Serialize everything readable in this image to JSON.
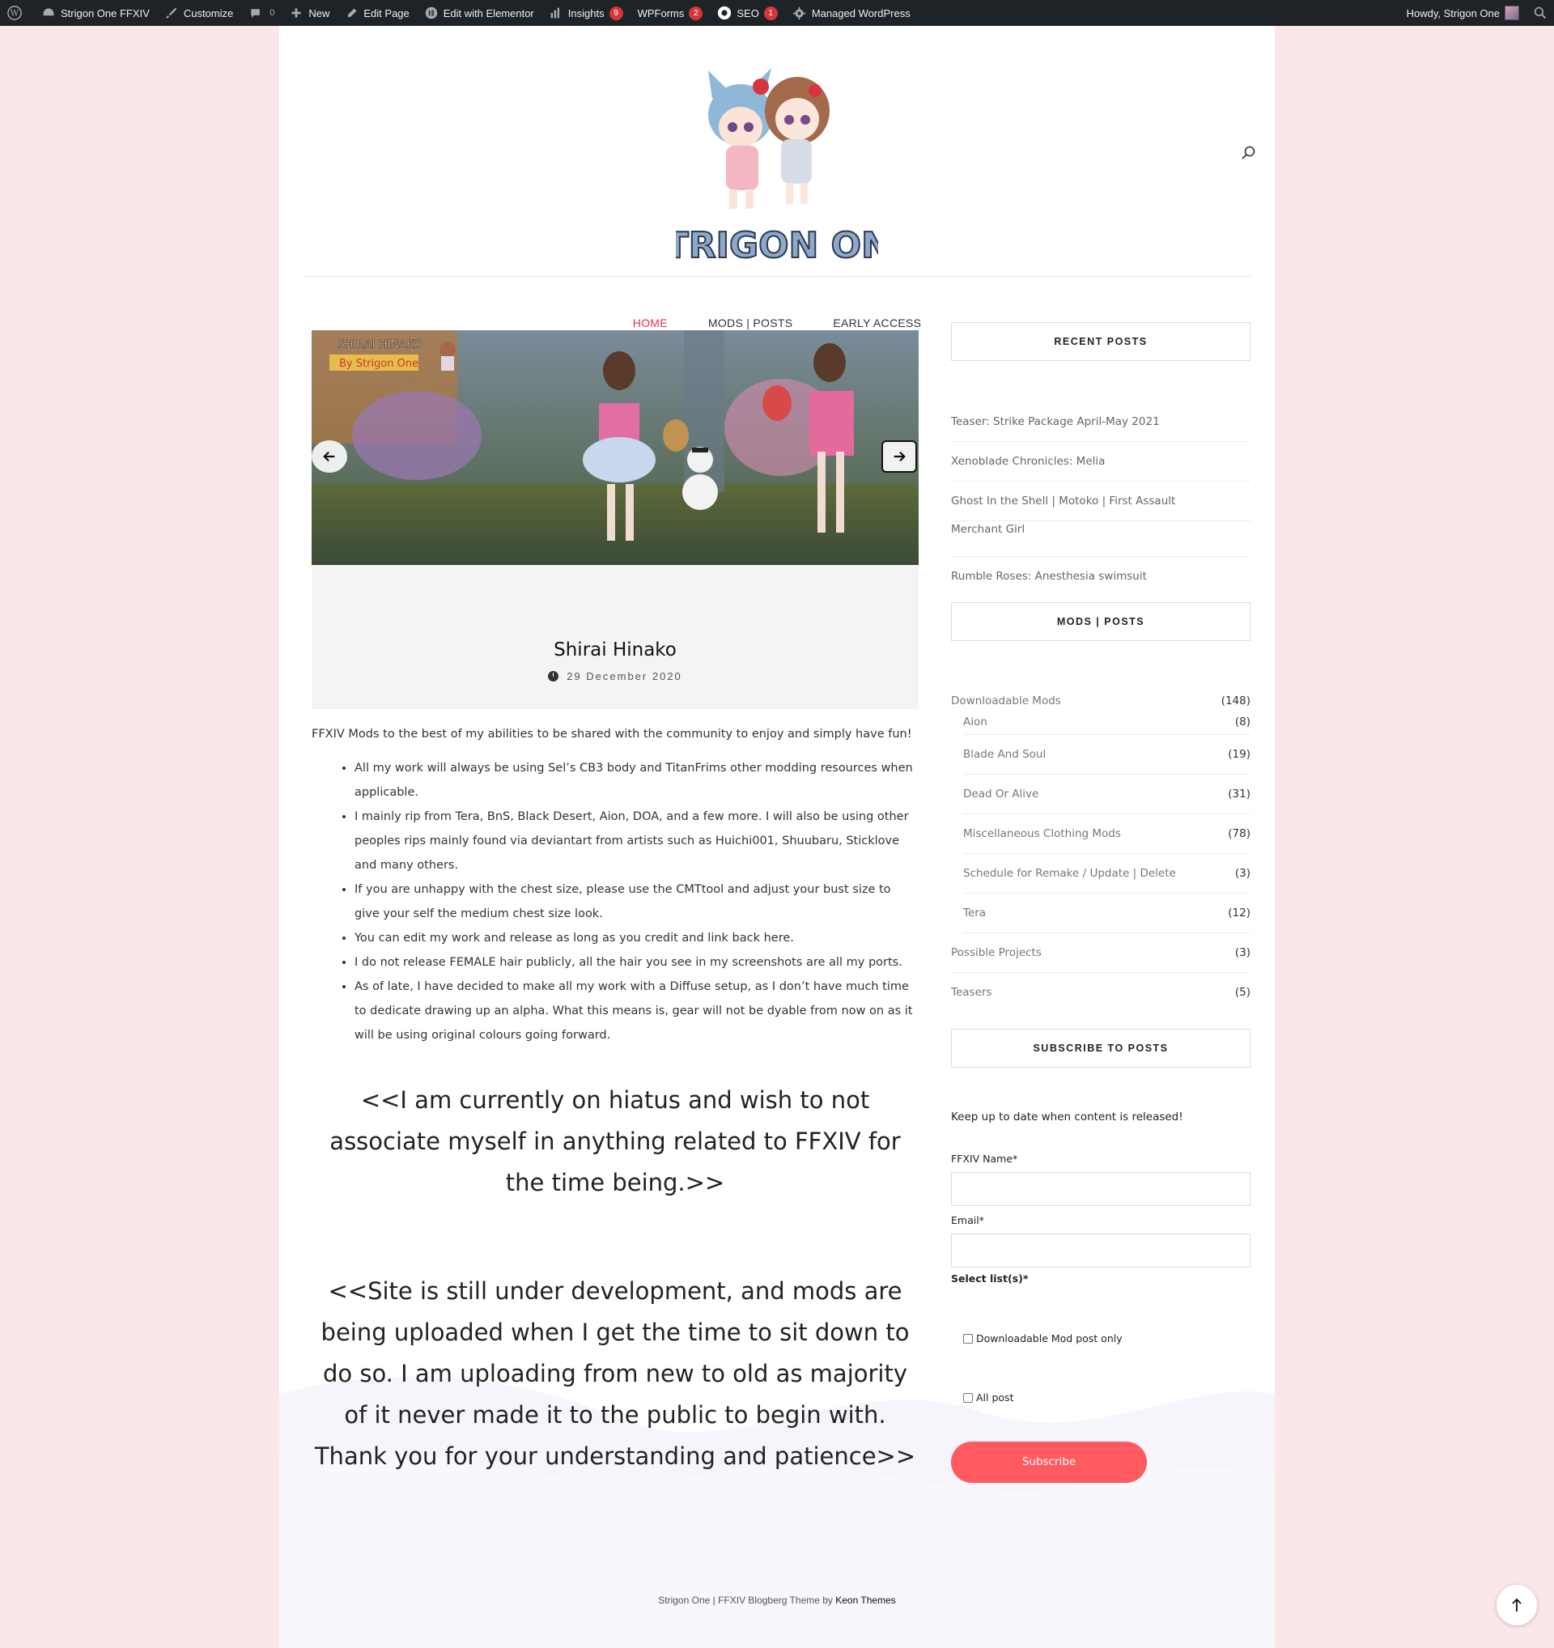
{
  "adminbar": {
    "site_name": "Strigon One FFXIV",
    "customize": "Customize",
    "comments_count": "0",
    "new": "New",
    "edit_page": "Edit Page",
    "edit_elementor": "Edit with Elementor",
    "insights": "Insights",
    "insights_badge": "9",
    "wpforms": "WPForms",
    "wpforms_badge": "2",
    "seo": "SEO",
    "seo_badge": "1",
    "managed": "Managed WordPress",
    "howdy": "Howdy, Strigon One"
  },
  "logo": {
    "text": "STRIGON ONE"
  },
  "nav": {
    "items": [
      "HOME",
      "MODS | POSTS",
      "EARLY ACCESS"
    ]
  },
  "slider": {
    "caption_line1": "SHIRAI HINAKO",
    "caption_line2": "By Strigon One"
  },
  "post": {
    "title": "Shirai Hinako",
    "date": "29 December 2020",
    "intro": "FFXIV Mods to the best of my abilities to be shared with the community to enjoy and simply have fun!",
    "bullets": [
      "All my work will always be using Sel’s CB3 body and TitanFrims other modding resources when applicable.",
      "I mainly rip from Tera, BnS, Black Desert, Aion, DOA, and a few more. I will also be using other peoples rips mainly found via deviantart from artists such as Huichi001, Shuubaru, Sticklove and many others.",
      "If you are unhappy with the chest size, please use the CMTtool and adjust your bust size to give your self the medium chest size look.",
      "You can edit my work and release as long as you credit and link back here.",
      "I do not release FEMALE hair publicly, all the hair you see in my screenshots are all my ports.",
      "As of late, I have decided to make all my work with a Diffuse setup, as I don’t have much time to dedicate drawing up an alpha. What this means is, gear will not be dyable from now on as it will be using original colours going forward."
    ],
    "hiatus": "<<I am currently on hiatus and wish to not associate myself in anything related to FFXIV for the time being.>>",
    "development": "<<Site is still under development, and mods are being uploaded when I get the time to sit down to do so. I am uploading from new to old as majority of it never made it to the public to begin with. Thank you for your understanding and patience>>"
  },
  "sidebar": {
    "recent_title": "RECENT POSTS",
    "recent": [
      "Teaser: Strike Package April-May 2021",
      "Xenoblade Chronicles: Melia",
      "Ghost In the Shell | Motoko | First Assault",
      "Merchant Girl",
      "Rumble Roses: Anesthesia swimsuit"
    ],
    "mods_title": "MODS | POSTS",
    "categories": [
      {
        "name": "Downloadable Mods",
        "count": "(148)",
        "level": 0
      },
      {
        "name": "Aion",
        "count": "(8)",
        "level": 1
      },
      {
        "name": "Blade And Soul",
        "count": "(19)",
        "level": 1
      },
      {
        "name": "Dead Or Alive",
        "count": "(31)",
        "level": 1
      },
      {
        "name": "Miscellaneous Clothing Mods",
        "count": "(78)",
        "level": 1
      },
      {
        "name": "Schedule for Remake / Update | Delete",
        "count": "(3)",
        "level": 1
      },
      {
        "name": "Tera",
        "count": "(12)",
        "level": 1
      },
      {
        "name": "Possible Projects",
        "count": "(3)",
        "level": 0
      },
      {
        "name": "Teasers",
        "count": "(5)",
        "level": 0
      }
    ],
    "subscribe_title": "SUBSCRIBE TO POSTS",
    "subscribe_desc": "Keep up to date when content is released!",
    "name_label": "FFXIV Name*",
    "email_label": "Email*",
    "lists_label": "Select list(s)*",
    "option1": "Downloadable Mod post only",
    "option2": "All post",
    "subscribe_button": "Subscribe"
  },
  "footer": {
    "text": "Strigon One | FFXIV Blogberg Theme by ",
    "link": "Keon Themes"
  },
  "colors": {
    "accent": "#e0344c",
    "button": "#ff5a5f",
    "adminbar": "#1d2327",
    "background": "#fbe7ea"
  }
}
